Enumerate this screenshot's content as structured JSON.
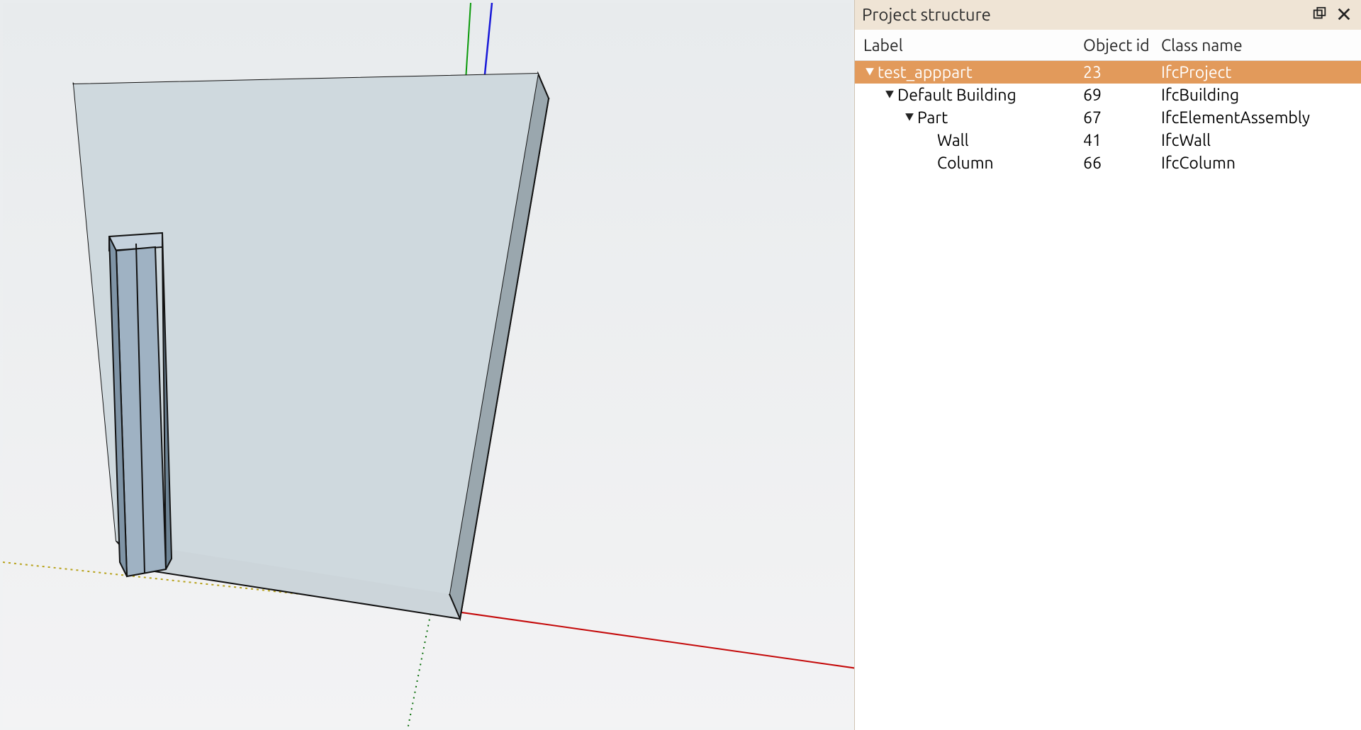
{
  "panel": {
    "title": "Project structure",
    "columns": {
      "label": "Label",
      "object_id": "Object id",
      "class_name": "Class name"
    }
  },
  "tree": [
    {
      "depth": 0,
      "arrow": true,
      "label": "test_apppart",
      "id": "23",
      "cls": "IfcProject",
      "selected": true
    },
    {
      "depth": 1,
      "arrow": true,
      "label": "Default Building",
      "id": "69",
      "cls": "IfcBuilding",
      "selected": false
    },
    {
      "depth": 2,
      "arrow": true,
      "label": "Part",
      "id": "67",
      "cls": "IfcElementAssembly",
      "selected": false
    },
    {
      "depth": 3,
      "arrow": false,
      "label": "Wall",
      "id": "41",
      "cls": "IfcWall",
      "selected": false
    },
    {
      "depth": 3,
      "arrow": false,
      "label": "Column",
      "id": "66",
      "cls": "IfcColumn",
      "selected": false
    }
  ]
}
